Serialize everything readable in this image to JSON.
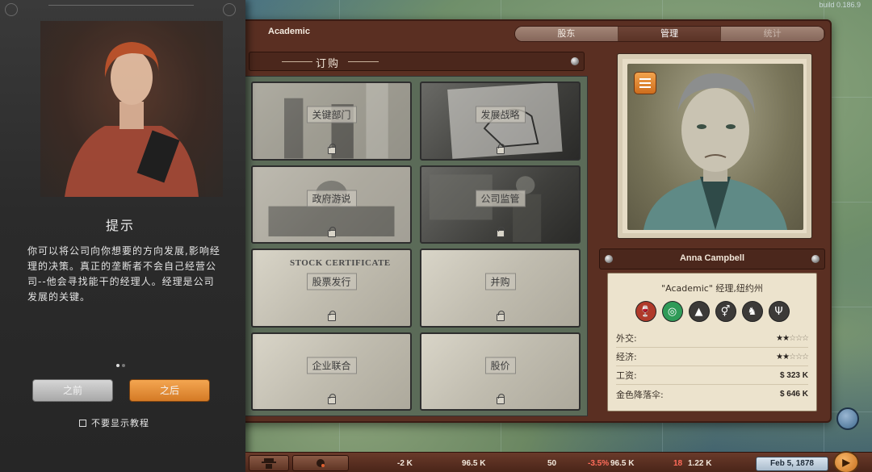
{
  "build": "build 0.186.9",
  "window": {
    "title": "Academic",
    "tabs": [
      {
        "label": "股东",
        "state": "normal"
      },
      {
        "label": "管理",
        "state": "active"
      },
      {
        "label": "统计",
        "state": "dim"
      }
    ]
  },
  "order": {
    "title": "订购",
    "cards": [
      {
        "label": "关键部门",
        "style": "photo"
      },
      {
        "label": "发展战略",
        "style": "dark"
      },
      {
        "label": "政府游说",
        "style": "photo"
      },
      {
        "label": "公司监管",
        "style": "dark"
      },
      {
        "label": "股票发行",
        "style": "paper",
        "art_text": "STOCK CERTIFICATE"
      },
      {
        "label": "并购",
        "style": "paper"
      },
      {
        "label": "企业联合",
        "style": "paper"
      },
      {
        "label": "股价",
        "style": "paper"
      }
    ]
  },
  "manager": {
    "name": "Anna Campbell",
    "role": "\"Academic\" 经理,纽约州",
    "traits": [
      {
        "icon": "wine-icon",
        "glyph": "🍷",
        "color": "red"
      },
      {
        "icon": "spiral-icon",
        "glyph": "◎",
        "color": "green"
      },
      {
        "icon": "rocket-icon",
        "glyph": "▲",
        "color": "dark"
      },
      {
        "icon": "gender-icon",
        "glyph": "⚥",
        "color": "dark"
      },
      {
        "icon": "horse-icon",
        "glyph": "♞",
        "color": "dark"
      },
      {
        "icon": "deer-icon",
        "glyph": "Ψ",
        "color": "dark"
      }
    ],
    "stats": [
      {
        "label": "外交:",
        "filled": 2,
        "total": 5
      },
      {
        "label": "经济:",
        "filled": 2,
        "total": 5
      }
    ],
    "salary_label": "工资:",
    "salary_value": "$ 323 K",
    "parachute_label": "金色降落伞:",
    "parachute_value": "$ 646 K"
  },
  "tutorial": {
    "heading": "提示",
    "body": "你可以将公司向你想要的方向发展,影响经理的决策。真正的垄断者不会自己经营公司--他会寻找能干的经理人。经理是公司发展的关键。",
    "prev_label": "之前",
    "next_label": "之后",
    "skip_label": "不要显示教程",
    "page_count": 2,
    "current_page": 1
  },
  "status_bar": {
    "cash_change": "-2 K",
    "cash": "96.5 K",
    "count": "50",
    "percent": "-3.5%",
    "value": "96.5 K",
    "shares": "18",
    "price": "1.22 K",
    "date": "Feb 5, 1878"
  }
}
